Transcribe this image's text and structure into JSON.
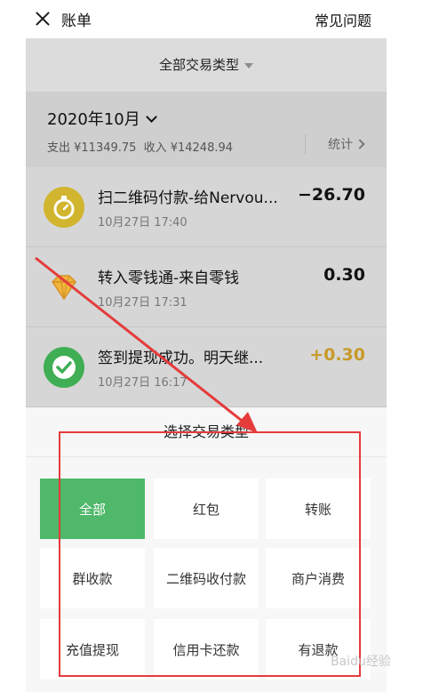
{
  "header": {
    "title": "账单",
    "faq": "常见问题"
  },
  "filter": {
    "label": "全部交易类型"
  },
  "month": {
    "label": "2020年10月",
    "expense": "支出 ¥11349.75",
    "income": "收入 ¥14248.94",
    "stats": "统计"
  },
  "transactions": [
    {
      "name": "扫二维码付款-给Nervou...",
      "time": "10月27日 17:40",
      "amount": "−26.70",
      "icon": "stopwatch-icon"
    },
    {
      "name": "转入零钱通-来自零钱",
      "time": "10月27日 17:31",
      "amount": "0.30",
      "icon": "diamond-icon"
    },
    {
      "name": "签到提现成功。明天继...",
      "time": "10月27日 16:17",
      "amount": "+0.30",
      "icon": "checkmark-badge-icon"
    }
  ],
  "sheet": {
    "title": "选择交易类型",
    "options": [
      "全部",
      "红包",
      "转账",
      "群收款",
      "二维码收付款",
      "商户消费",
      "充值提现",
      "信用卡还款",
      "有退款"
    ],
    "selected": "全部"
  },
  "watermark": "Baidu经验",
  "colors": {
    "accent": "#4fb86a",
    "annotation": "#e53b3b",
    "income": "#c89a2a"
  }
}
